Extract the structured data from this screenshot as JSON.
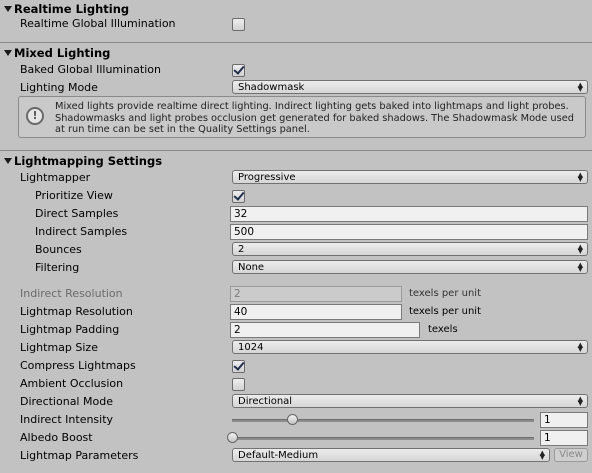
{
  "realtime": {
    "title": "Realtime Lighting",
    "global_illumination_label": "Realtime Global Illumination",
    "global_illumination_checked": false
  },
  "mixed": {
    "title": "Mixed Lighting",
    "baked_gi_label": "Baked Global Illumination",
    "baked_gi_checked": true,
    "lighting_mode_label": "Lighting Mode",
    "lighting_mode_value": "Shadowmask",
    "help_text": "Mixed lights provide realtime direct lighting. Indirect lighting gets baked into lightmaps and light probes. Shadowmasks and light probes occlusion get generated for baked shadows. The Shadowmask Mode used at run time can be set in the Quality Settings panel."
  },
  "lightmapping": {
    "title": "Lightmapping Settings",
    "lightmapper_label": "Lightmapper",
    "lightmapper_value": "Progressive",
    "prioritize_view_label": "Prioritize View",
    "prioritize_view_checked": true,
    "direct_samples_label": "Direct Samples",
    "direct_samples_value": "32",
    "indirect_samples_label": "Indirect Samples",
    "indirect_samples_value": "500",
    "bounces_label": "Bounces",
    "bounces_value": "2",
    "filtering_label": "Filtering",
    "filtering_value": "None",
    "indirect_resolution_label": "Indirect Resolution",
    "indirect_resolution_value": "2",
    "indirect_resolution_unit": "texels per unit",
    "lightmap_resolution_label": "Lightmap Resolution",
    "lightmap_resolution_value": "40",
    "lightmap_resolution_unit": "texels per unit",
    "lightmap_padding_label": "Lightmap Padding",
    "lightmap_padding_value": "2",
    "lightmap_padding_unit": "texels",
    "lightmap_size_label": "Lightmap Size",
    "lightmap_size_value": "1024",
    "compress_label": "Compress Lightmaps",
    "compress_checked": true,
    "ambient_occlusion_label": "Ambient Occlusion",
    "ambient_occlusion_checked": false,
    "directional_mode_label": "Directional Mode",
    "directional_mode_value": "Directional",
    "indirect_intensity_label": "Indirect Intensity",
    "indirect_intensity_value": "1",
    "indirect_intensity_fraction": 0.2,
    "albedo_boost_label": "Albedo Boost",
    "albedo_boost_value": "1",
    "albedo_boost_fraction": 0.0,
    "lightmap_parameters_label": "Lightmap Parameters",
    "lightmap_parameters_value": "Default-Medium",
    "view_button_label": "View"
  },
  "icons": {
    "fold_arrow": "triangle-down-icon",
    "help": "info-bubble-icon",
    "dropdown_arrow": "up-down-chevron-icon"
  }
}
